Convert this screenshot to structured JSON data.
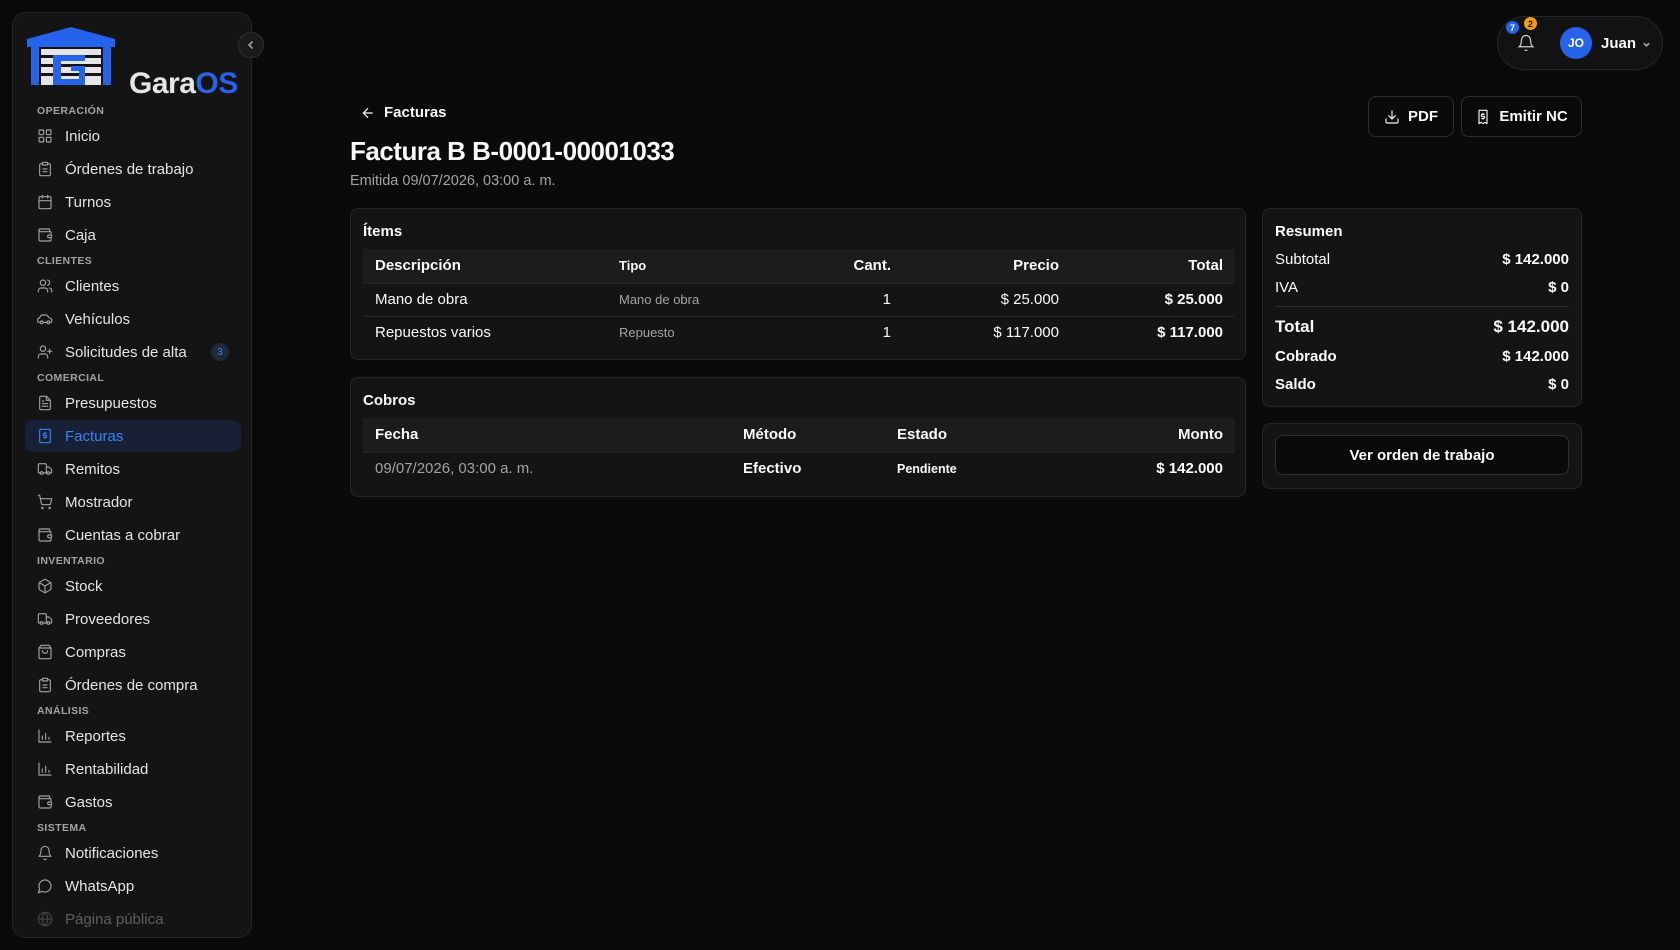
{
  "brand": {
    "name_part1": "Gara",
    "name_part2": "OS"
  },
  "sidebar": {
    "sections": [
      {
        "label": "OPERACIÓN",
        "items": [
          {
            "label": "Inicio",
            "icon": "grid-icon"
          },
          {
            "label": "Órdenes de trabajo",
            "icon": "clipboard-icon"
          },
          {
            "label": "Turnos",
            "icon": "calendar-icon"
          },
          {
            "label": "Caja",
            "icon": "wallet-icon"
          }
        ]
      },
      {
        "label": "CLIENTES",
        "items": [
          {
            "label": "Clientes",
            "icon": "users-icon"
          },
          {
            "label": "Vehículos",
            "icon": "car-icon"
          },
          {
            "label": "Solicitudes de alta",
            "icon": "user-plus-icon",
            "badge": "3"
          }
        ]
      },
      {
        "label": "COMERCIAL",
        "items": [
          {
            "label": "Presupuestos",
            "icon": "file-text-icon"
          },
          {
            "label": "Facturas",
            "icon": "receipt-icon",
            "active": true
          },
          {
            "label": "Remitos",
            "icon": "truck-icon"
          },
          {
            "label": "Mostrador",
            "icon": "cart-icon"
          },
          {
            "label": "Cuentas a cobrar",
            "icon": "wallet-icon"
          }
        ]
      },
      {
        "label": "INVENTARIO",
        "items": [
          {
            "label": "Stock",
            "icon": "package-icon"
          },
          {
            "label": "Proveedores",
            "icon": "truck-icon"
          },
          {
            "label": "Compras",
            "icon": "shopping-bag-icon"
          },
          {
            "label": "Órdenes de compra",
            "icon": "clipboard-icon"
          }
        ]
      },
      {
        "label": "ANÁLISIS",
        "items": [
          {
            "label": "Reportes",
            "icon": "bar-chart-icon"
          },
          {
            "label": "Rentabilidad",
            "icon": "bar-chart-icon"
          },
          {
            "label": "Gastos",
            "icon": "wallet-icon"
          }
        ]
      },
      {
        "label": "SISTEMA",
        "items": [
          {
            "label": "Notificaciones",
            "icon": "bell-icon"
          },
          {
            "label": "WhatsApp",
            "icon": "message-icon"
          },
          {
            "label": "Página pública",
            "icon": "globe-icon",
            "faded": true
          }
        ]
      }
    ]
  },
  "topbar": {
    "notif_blue": "7",
    "notif_orange": "2",
    "avatar_initials": "JO",
    "user_name": "Juan"
  },
  "header": {
    "back_label": "Facturas",
    "title": "Factura B B-0001-00001033",
    "subtitle": "Emitida 09/07/2026, 03:00 a. m.",
    "pdf_label": "PDF",
    "nc_label": "Emitir NC"
  },
  "items_card": {
    "title": "Ítems",
    "columns": [
      "Descripción",
      "Tipo",
      "Cant.",
      "Precio",
      "Total"
    ],
    "rows": [
      {
        "descripcion": "Mano de obra",
        "tipo": "Mano de obra",
        "cant": "1",
        "precio": "$ 25.000",
        "total": "$ 25.000"
      },
      {
        "descripcion": "Repuestos varios",
        "tipo": "Repuesto",
        "cant": "1",
        "precio": "$ 117.000",
        "total": "$ 117.000"
      }
    ]
  },
  "cobros_card": {
    "title": "Cobros",
    "columns": [
      "Fecha",
      "Método",
      "Estado",
      "Monto"
    ],
    "rows": [
      {
        "fecha": "09/07/2026, 03:00 a. m.",
        "metodo": "Efectivo",
        "estado": "Pendiente",
        "monto": "$ 142.000"
      }
    ]
  },
  "resumen": {
    "title": "Resumen",
    "subtotal_label": "Subtotal",
    "subtotal": "$ 142.000",
    "iva_label": "IVA",
    "iva": "$ 0",
    "total_label": "Total",
    "total": "$ 142.000",
    "cobrado_label": "Cobrado",
    "cobrado": "$ 142.000",
    "saldo_label": "Saldo",
    "saldo": "$ 0"
  },
  "ver_orden_label": "Ver orden de trabajo",
  "colors": {
    "accent": "#2563eb",
    "background": "#0a0a0a",
    "card": "#141414",
    "badge_orange": "#f59e0b"
  }
}
